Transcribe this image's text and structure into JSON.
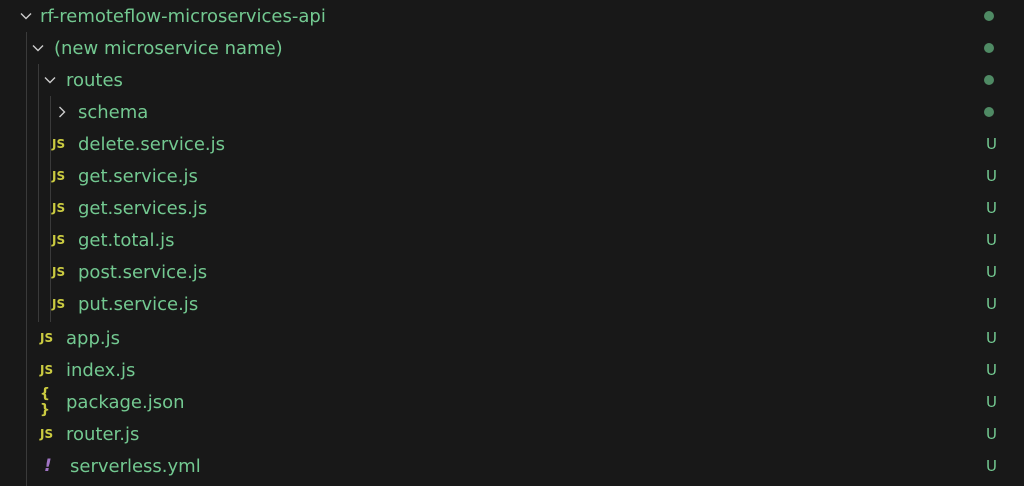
{
  "tree": {
    "rows": [
      {
        "label": "rf-remoteflow-microservices-api",
        "kind": "folder",
        "expanded": true,
        "status": "dot"
      },
      {
        "label": "(new microservice name)",
        "kind": "folder",
        "expanded": true,
        "status": "dot"
      },
      {
        "label": "routes",
        "kind": "folder",
        "expanded": true,
        "status": "dot"
      },
      {
        "label": "schema",
        "kind": "folder",
        "expanded": false,
        "status": "dot"
      },
      {
        "label": "delete.service.js",
        "kind": "js",
        "icon": "JS",
        "status": "U"
      },
      {
        "label": "get.service.js",
        "kind": "js",
        "icon": "JS",
        "status": "U"
      },
      {
        "label": "get.services.js",
        "kind": "js",
        "icon": "JS",
        "status": "U"
      },
      {
        "label": "get.total.js",
        "kind": "js",
        "icon": "JS",
        "status": "U"
      },
      {
        "label": "post.service.js",
        "kind": "js",
        "icon": "JS",
        "status": "U"
      },
      {
        "label": "put.service.js",
        "kind": "js",
        "icon": "JS",
        "status": "U"
      },
      {
        "label": "app.js",
        "kind": "js",
        "icon": "JS",
        "status": "U"
      },
      {
        "label": "index.js",
        "kind": "js",
        "icon": "JS",
        "status": "U"
      },
      {
        "label": "package.json",
        "kind": "json",
        "icon": "{ }",
        "status": "U"
      },
      {
        "label": "router.js",
        "kind": "js",
        "icon": "JS",
        "status": "U"
      },
      {
        "label": "serverless.yml",
        "kind": "yml",
        "icon": "!",
        "status": "U"
      }
    ]
  },
  "colors": {
    "background": "#181818",
    "untracked_green": "#73c991",
    "js_icon": "#cbcb41",
    "yml_icon": "#a074c4"
  }
}
